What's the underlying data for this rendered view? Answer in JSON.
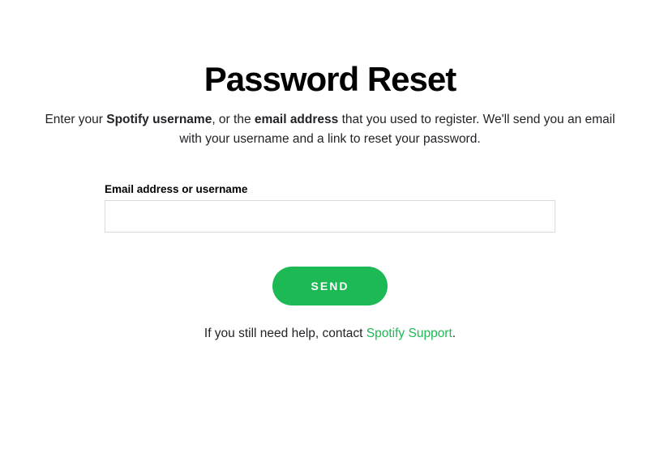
{
  "page": {
    "title": "Password Reset",
    "description_pre": "Enter your ",
    "description_bold1": "Spotify username",
    "description_mid": ", or the ",
    "description_bold2": "email address",
    "description_post": " that you used to register. We'll send you an email with your username and a link to reset your password."
  },
  "form": {
    "label": "Email address or username",
    "input_value": "",
    "submit_label": "Send"
  },
  "help": {
    "text": "If you still need help, contact ",
    "link_text": "Spotify Support",
    "suffix": "."
  },
  "colors": {
    "accent": "#1db954",
    "text": "#222326",
    "border": "#d9dadc"
  }
}
